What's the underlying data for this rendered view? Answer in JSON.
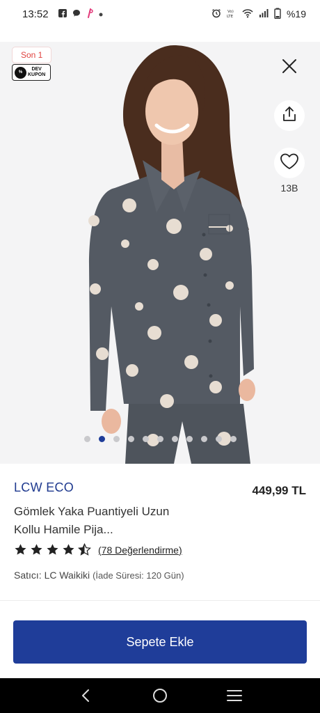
{
  "status_bar": {
    "time": "13:52",
    "battery": "%19",
    "network": "Vo) LTE"
  },
  "product": {
    "badge_label": "Son 1",
    "coupon_label_line1": "DEV",
    "coupon_label_line2": "KUPON",
    "favorites_count": "13B",
    "brand": "LCW ECO",
    "price": "449,99 TL",
    "title": "Gömlek Yaka Puantiyeli Uzun Kollu Hamile Pija...",
    "rating_value": 4.5,
    "review_label": "(78 Değerlendirme)",
    "seller": "Satıcı: LC Waikiki",
    "return_period": "(İade Süresi: 120 Gün)",
    "image_count": 11,
    "active_image_index": 1,
    "add_to_cart_label": "Sepete Ekle"
  },
  "colors": {
    "accent": "#1f3d99",
    "brand_text": "#1f3a8f",
    "badge_red": "#e0433f"
  }
}
